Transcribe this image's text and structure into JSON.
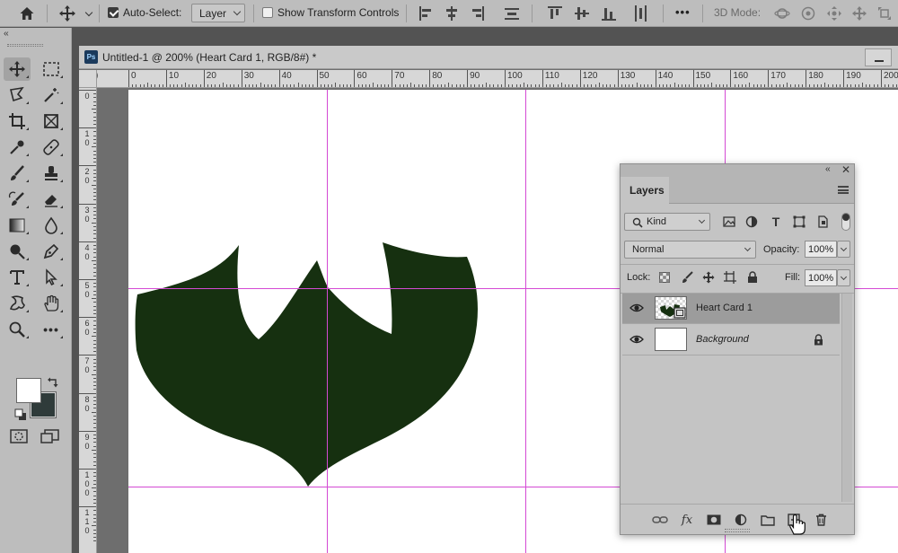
{
  "options_bar": {
    "home_icon": "home-icon",
    "move_icon": "move-tool-icon",
    "auto_select_label": "Auto-Select:",
    "auto_select_checked": true,
    "auto_select_target": "Layer",
    "show_transform_label": "Show Transform Controls",
    "show_transform_checked": false,
    "more_label": "•••",
    "mode_3d_label": "3D Mode:"
  },
  "document": {
    "app_badge": "Ps",
    "tab_title": "Untitled-1 @ 200% (Heart Card 1, RGB/8#) *",
    "ruler_h_labels": [
      "0",
      "10",
      "20",
      "30",
      "40",
      "50",
      "60",
      "70",
      "80",
      "90",
      "100",
      "110",
      "120",
      "130",
      "140",
      "150",
      "160",
      "170",
      "180",
      "190",
      "200"
    ],
    "ruler_v_labels": [
      "0",
      "1 0",
      "2 0",
      "3 0",
      "4 0",
      "5 0",
      "6 0",
      "7 0",
      "8 0",
      "9 0",
      "1 0 0",
      "1 1 0"
    ],
    "shape_color": "#163010"
  },
  "tools": {
    "collapse": "‹‹",
    "fg_color": "#ffffff",
    "bg_color": "#2f3b3a"
  },
  "layers_panel": {
    "tab_label": "Layers",
    "filter_kind": "Kind",
    "blend_mode": "Normal",
    "opacity_label": "Opacity:",
    "opacity_value": "100%",
    "lock_label": "Lock:",
    "fill_label": "Fill:",
    "fill_value": "100%",
    "layers": [
      {
        "name": "Heart Card 1",
        "selected": true,
        "visible": true,
        "locked": false
      },
      {
        "name": "Background",
        "selected": false,
        "visible": true,
        "locked": true
      }
    ],
    "footer_fx": "fx"
  }
}
